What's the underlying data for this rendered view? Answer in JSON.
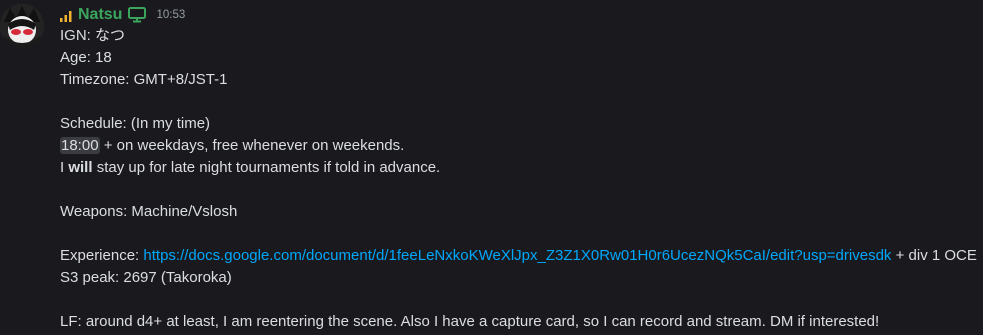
{
  "message": {
    "author": "Natsu",
    "timestamp": "10:53",
    "lines": {
      "ign": "IGN: なつ",
      "age": "Age: 18",
      "timezone": "Timezone: GMT+8/JST-1",
      "schedule": "Schedule: (In my time)",
      "weekday_time": "18:00",
      "weekday_rest": "+ on weekdays, free whenever on weekends.",
      "stayup_prefix": "I",
      "stayup_bold": "will",
      "stayup_rest": "stay up for late night tournaments if told in advance.",
      "weapons": "Weapons: Machine/Vslosh",
      "experience_label": "Experience:",
      "experience_link": "https://docs.google.com/document/d/1feeLeNxkoKWeXlJpx_Z3Z1X0Rw01H0r6UcezNQk5CaI/edit?usp=drivesdk",
      "experience_rest": "+ div 1 OCE",
      "s3_peak": "S3 peak: 2697 (Takoroka)",
      "lf": "LF: around d4+ at least, I am reentering the scene. Also I have a capture card, so I can record and stream. DM if interested!"
    }
  },
  "colors": {
    "background": "#1a1a1e",
    "username": "#3ba55d",
    "link": "#00a8fc",
    "text": "#dbdee1",
    "timestamp": "#949ba4"
  },
  "icons": [
    "avatar",
    "signal-bars-icon",
    "monitor-icon"
  ]
}
